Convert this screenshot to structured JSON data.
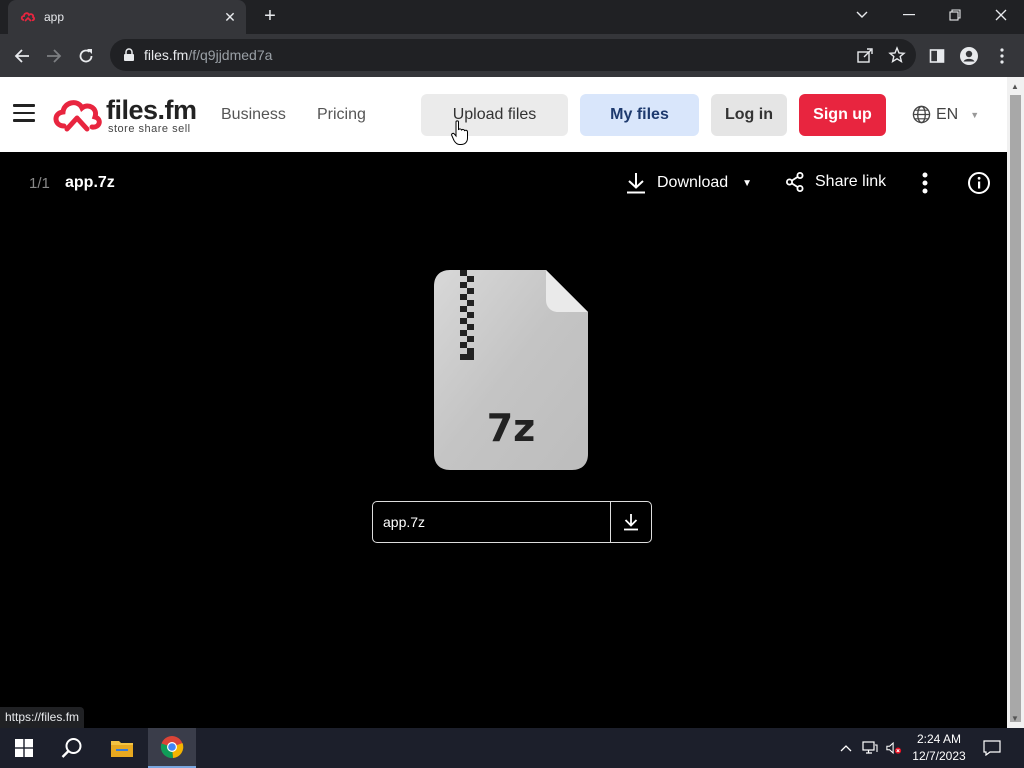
{
  "browser": {
    "tab_title": "app",
    "url_host": "files.fm",
    "url_path": "/f/q9jjdmed7a",
    "status_url": "https://files.fm"
  },
  "header": {
    "logo_word": "files.fm",
    "logo_tagline": "store share sell",
    "nav": [
      {
        "label": "Business"
      },
      {
        "label": "Pricing"
      }
    ],
    "upload_label": "Upload files",
    "myfiles_label": "My files",
    "login_label": "Log in",
    "signup_label": "Sign up",
    "language": "EN"
  },
  "viewer": {
    "counter": "1/1",
    "file_title": "app.7z",
    "download_label": "Download",
    "share_label": "Share link",
    "icon_ext": "7z",
    "name_box": "app.7z"
  },
  "taskbar": {
    "time": "2:24 AM",
    "date": "12/7/2023"
  },
  "colors": {
    "brand_red": "#e8253f",
    "myfiles_bg": "#d9e6fb",
    "page_bg": "#000000"
  }
}
